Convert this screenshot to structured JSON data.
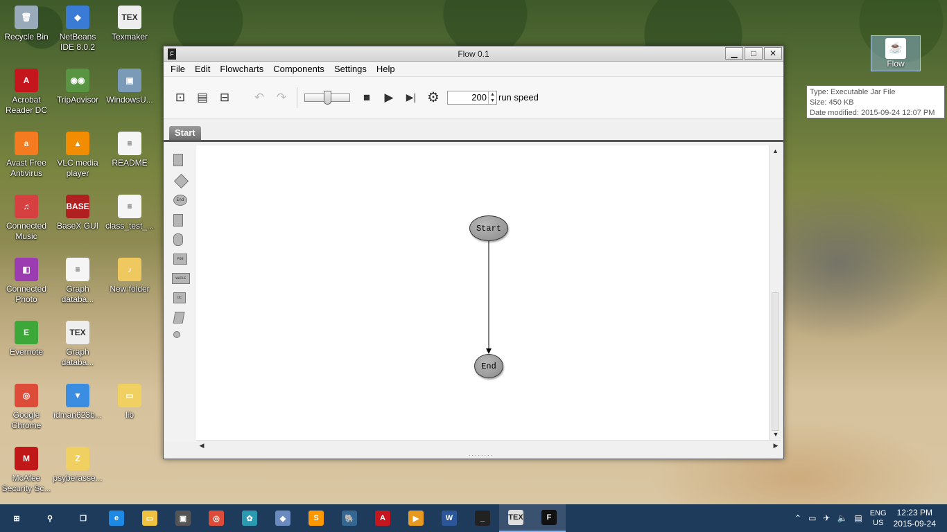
{
  "desktop": {
    "icons": [
      {
        "label": "Recycle Bin",
        "glyph": "🗑",
        "color": "#9ab"
      },
      {
        "label": "NetBeans IDE 8.0.2",
        "glyph": "◆",
        "color": "#3a7bd5"
      },
      {
        "label": "Texmaker",
        "glyph": "TEX",
        "color": "#eeeeee"
      },
      {
        "label": "Acrobat Reader DC",
        "glyph": "A",
        "color": "#c4161c"
      },
      {
        "label": "TripAdvisor",
        "glyph": "◉◉",
        "color": "#589442"
      },
      {
        "label": "WindowsU...",
        "glyph": "▣",
        "color": "#7a9ab8"
      },
      {
        "label": "Avast Free Antivirus",
        "glyph": "a",
        "color": "#f47b20"
      },
      {
        "label": "VLC media player",
        "glyph": "▲",
        "color": "#f28c00"
      },
      {
        "label": "README",
        "glyph": "≡",
        "color": "#f5f5f5"
      },
      {
        "label": "Connected Music",
        "glyph": "♫",
        "color": "#d64040"
      },
      {
        "label": "BaseX GUI",
        "glyph": "BASE",
        "color": "#b02020"
      },
      {
        "label": "class_test_...",
        "glyph": "≡",
        "color": "#f5f5f5"
      },
      {
        "label": "Connected Photo",
        "glyph": "◧",
        "color": "#9b3db0"
      },
      {
        "label": "Graph databa...",
        "glyph": "≡",
        "color": "#f5f5f5"
      },
      {
        "label": "New folder",
        "glyph": "♪",
        "color": "#f0c860"
      },
      {
        "label": "Evernote",
        "glyph": "E",
        "color": "#3ea73a"
      },
      {
        "label": "Graph databa...",
        "glyph": "TEX",
        "color": "#eeeeee"
      },
      {
        "label": "Google Chrome",
        "glyph": "◎",
        "color": "#dd4b39"
      },
      {
        "label": "idman623b...",
        "glyph": "▼",
        "color": "#3a8de0"
      },
      {
        "label": "lib",
        "glyph": "▭",
        "color": "#f0d060"
      },
      {
        "label": "McAfee Security Sc...",
        "glyph": "M",
        "color": "#c01818"
      },
      {
        "label": "psyberasse...",
        "glyph": "Z",
        "color": "#f0d060"
      }
    ],
    "flow_file": {
      "label": "Flow",
      "glyph": "☕"
    },
    "tooltip": {
      "type": "Type: Executable Jar File",
      "size": "Size: 450 KB",
      "modified": "Date modified: 2015-09-24 12:07 PM"
    }
  },
  "window": {
    "title": "Flow 0.1",
    "app_icon": "F",
    "controls": {
      "minimize": "▁",
      "maximize": "□",
      "close": "✕"
    },
    "menu": [
      "File",
      "Edit",
      "Flowcharts",
      "Components",
      "Settings",
      "Help"
    ],
    "toolbar": {
      "new_glyph": "⊡",
      "open_glyph": "▤",
      "save_glyph": "⊟",
      "undo_glyph": "↶",
      "redo_glyph": "↷",
      "stop_glyph": "■",
      "play_glyph": "▶",
      "step_glyph": "▶|",
      "settings_glyph": "⚙",
      "speed_value": "200",
      "speed_label": "run speed",
      "slider_fraction": 0.5
    },
    "tabs": [
      "Start"
    ],
    "flowchart": {
      "nodes": [
        {
          "id": "start",
          "label": "Start"
        },
        {
          "id": "end",
          "label": "End"
        }
      ]
    },
    "palette_labels": {
      "end": "End",
      "for": "FOR",
      "while": "WHILE",
      "oc": "OC"
    }
  },
  "taskbar": {
    "items": [
      {
        "name": "start-button",
        "glyph": "⊞",
        "color": ""
      },
      {
        "name": "search",
        "glyph": "⚲",
        "color": ""
      },
      {
        "name": "task-view",
        "glyph": "❐",
        "color": ""
      },
      {
        "name": "edge",
        "glyph": "e",
        "color": "#1e88e5"
      },
      {
        "name": "file-explorer",
        "glyph": "▭",
        "color": "#f0c040"
      },
      {
        "name": "store",
        "glyph": "▣",
        "color": "#555555"
      },
      {
        "name": "chrome",
        "glyph": "◎",
        "color": "#dd4b39"
      },
      {
        "name": "app-6",
        "glyph": "✿",
        "color": "#2a9ab0"
      },
      {
        "name": "virtualbox",
        "glyph": "◆",
        "color": "#6a8ac0"
      },
      {
        "name": "sublime",
        "glyph": "S",
        "color": "#ff9800"
      },
      {
        "name": "postgres",
        "glyph": "🐘",
        "color": "#336791"
      },
      {
        "name": "acrobat",
        "glyph": "A",
        "color": "#c4161c"
      },
      {
        "name": "media",
        "glyph": "▶",
        "color": "#e89a20"
      },
      {
        "name": "word",
        "glyph": "W",
        "color": "#2b579a"
      },
      {
        "name": "terminal",
        "glyph": "_",
        "color": "#222222"
      },
      {
        "name": "texmaker",
        "glyph": "TEX",
        "color": "#dddddd"
      },
      {
        "name": "flow",
        "glyph": "F",
        "color": "#111111"
      }
    ],
    "tray": {
      "lang_top": "ENG",
      "lang_bottom": "US",
      "time": "12:23 PM",
      "date": "2015-09-24"
    }
  }
}
